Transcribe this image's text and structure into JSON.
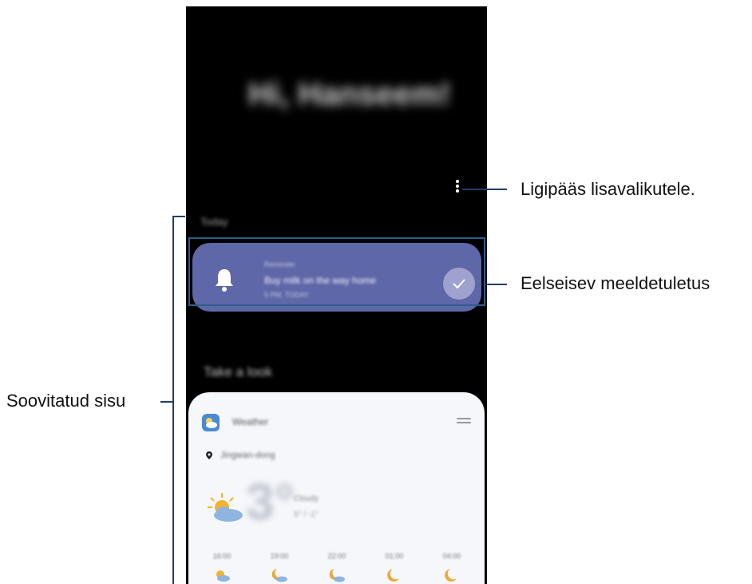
{
  "phone": {
    "greeting": "Hi, Hanseem!",
    "section_today": "Today",
    "reminder": {
      "title": "Reminder",
      "text": "Buy milk on the way home",
      "time": "5 PM, TODAY"
    },
    "section_look": "Take a look",
    "weather": {
      "title": "Weather",
      "location": "Jingwan-dong",
      "temperature": "3°",
      "description": "Cloudy",
      "range": "5° / -1°",
      "hours": [
        {
          "time": "16:00",
          "icon": "sun-cloud-icon"
        },
        {
          "time": "19:00",
          "icon": "moon-cloud-icon"
        },
        {
          "time": "22:00",
          "icon": "moon-cloud-icon"
        },
        {
          "time": "01:00",
          "icon": "moon-icon"
        },
        {
          "time": "04:00",
          "icon": "moon-icon"
        }
      ]
    }
  },
  "callouts": {
    "more_options": "Ligipääs lisavalikutele.",
    "reminder": "Eelseisev meeldetuletus",
    "suggested": "Soovitatud sisu"
  },
  "colors": {
    "reminder_card": "#5e67a8",
    "callout_line": "#1f3d6b",
    "weather_card": "#f5f7fb"
  }
}
